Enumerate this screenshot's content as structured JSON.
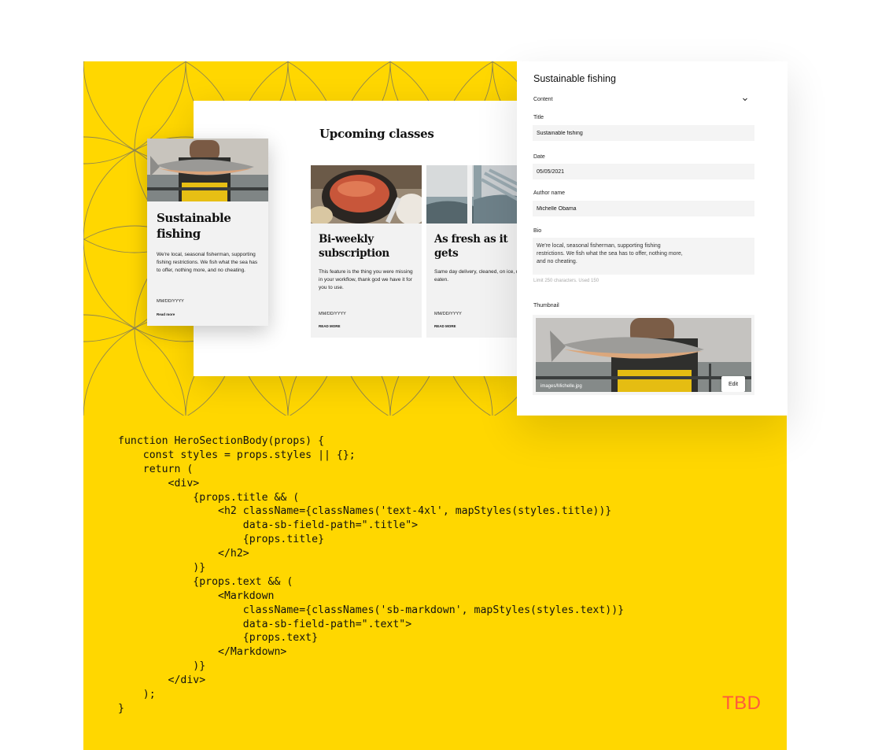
{
  "preview": {
    "section_title": "Upcoming classes",
    "cards": [
      {
        "title": "Sustainable fishing",
        "description": "We're local, seasonal fisherman, supporting fishing restrictions. We fish what the sea has to offer, nothing more, and no cheating.",
        "date": "MM/DD/YYYY",
        "link": "Read more"
      },
      {
        "title": "Bi-weekly subscription",
        "description": "This feature is the thing you were missing in your workflow, thank god we have it for you to use.",
        "date": "MM/DD/YYYY",
        "link": "READ MORE"
      },
      {
        "title": "As fresh as it gets",
        "description": "Same day delivery, cleaned, on ice, r to be eaten.",
        "date": "MM/DD/YYYY",
        "link": "READ MORE"
      }
    ]
  },
  "editor": {
    "heading": "Sustainable fishing",
    "section_label": "Content",
    "fields": {
      "title": {
        "label": "Title",
        "value": "Sustainable fishing"
      },
      "date": {
        "label": "Date",
        "value": "05/05/2021"
      },
      "author": {
        "label": "Author name",
        "value": "Michelle Obama"
      },
      "bio": {
        "label": "Bio",
        "value": "We're local, seasonal fisherman, supporting fishing restrictions. We fish what the sea has to offer, nothing more, and no cheating.",
        "hint": "Limit 250 characters. Used 150"
      },
      "thumbnail": {
        "label": "Thumbnail",
        "path": "images/Michelle.jpg",
        "edit_label": "Edit"
      }
    }
  },
  "code": {
    "lines": [
      "function HeroSectionBody(props) {",
      "    const styles = props.styles || {};",
      "    return (",
      "        <div>",
      "            {props.title && (",
      "                <h2 className={classNames('text-4xl', mapStyles(styles.title))}",
      "                    data-sb-field-path=\".title\">",
      "                    {props.title}",
      "                </h2>",
      "            )}",
      "            {props.text && (",
      "                <Markdown",
      "                    className={classNames('sb-markdown', mapStyles(styles.text))}",
      "                    data-sb-field-path=\".text\">",
      "                    {props.text}",
      "                </Markdown>",
      "            )}",
      "        </div>",
      "    );",
      "}"
    ]
  },
  "brand": {
    "text": "TBD",
    "color": "#FF5A3C"
  },
  "colors": {
    "background": "#FFD700",
    "card": "#f2f2f2",
    "input": "#f4f4f4"
  }
}
